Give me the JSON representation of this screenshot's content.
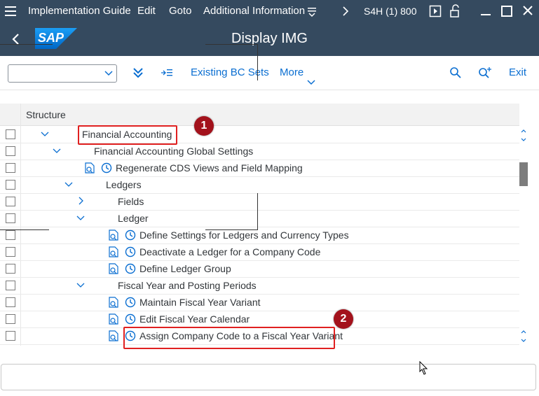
{
  "titlebar": {
    "menu": [
      "Implementation Guide",
      "Edit",
      "Goto",
      "Additional Information"
    ],
    "system": "S4H (1) 800"
  },
  "header": {
    "logo": "SAP",
    "title": "Display IMG"
  },
  "toolbar": {
    "select_value": "",
    "existing_bc_sets": "Existing BC Sets",
    "more": "More",
    "exit": "Exit"
  },
  "tree": {
    "column_header": "Structure",
    "rows": [
      {
        "label": "Financial Accounting",
        "level": 0,
        "expander": "expanded",
        "icons": false
      },
      {
        "label": "Financial Accounting Global Settings",
        "level": 1,
        "expander": "expanded",
        "icons": false
      },
      {
        "label": "Regenerate CDS Views and Field Mapping",
        "level": 2,
        "expander": "none",
        "icons": true
      },
      {
        "label": "Ledgers",
        "level": 2,
        "expander": "expanded",
        "icons": false
      },
      {
        "label": "Fields",
        "level": 3,
        "expander": "collapsed",
        "icons": false
      },
      {
        "label": "Ledger",
        "level": 3,
        "expander": "expanded",
        "icons": false
      },
      {
        "label": "Define Settings for Ledgers and Currency Types",
        "level": 4,
        "expander": "none",
        "icons": true
      },
      {
        "label": "Deactivate a Ledger for a Company Code",
        "level": 4,
        "expander": "none",
        "icons": true
      },
      {
        "label": "Define Ledger Group",
        "level": 4,
        "expander": "none",
        "icons": true
      },
      {
        "label": "Fiscal Year and Posting Periods",
        "level": 3,
        "expander": "expanded",
        "icons": false
      },
      {
        "label": "Maintain Fiscal Year Variant",
        "level": 4,
        "expander": "none",
        "icons": true
      },
      {
        "label": "Edit Fiscal Year Calendar",
        "level": 4,
        "expander": "none",
        "icons": true
      },
      {
        "label": "Assign Company Code to a Fiscal Year Variant",
        "level": 4,
        "expander": "none",
        "icons": true
      }
    ]
  },
  "annotations": {
    "badge1": "1",
    "badge2": "2",
    "highlight_color": "#e02020",
    "badge_color": "#a3121c"
  },
  "colors": {
    "shell": "#354a5f",
    "link": "#0a6ed1"
  }
}
